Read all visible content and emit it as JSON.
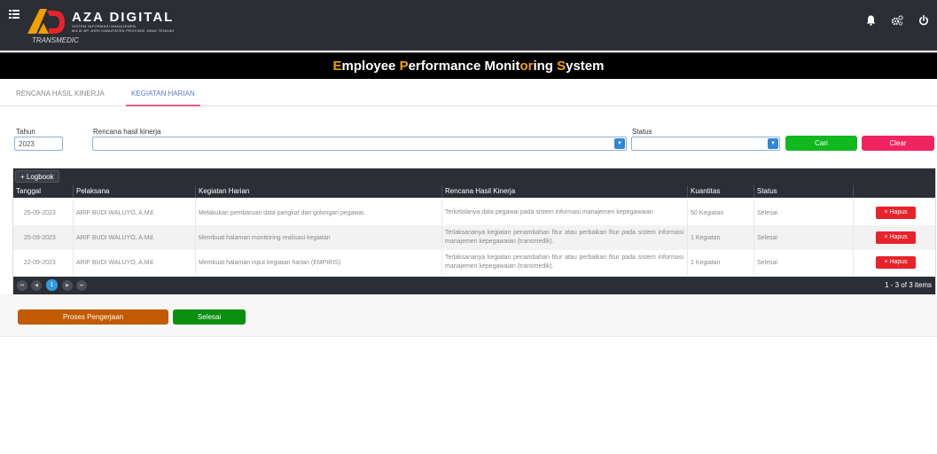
{
  "header": {
    "brand_title": "AZA DIGITAL",
    "brand_subtitle_1": "SISTEM INFORMASI MANAJEMEN",
    "brand_subtitle_2": "MILIK BP. ASRI KABUPATEN PROVINSI JAWA TENGAH",
    "brand_tagline": "TRANSMEDIC",
    "icons": [
      "menu-grid-icon",
      "bell-icon",
      "cogs-icon",
      "power-icon"
    ]
  },
  "page_title": {
    "parts": [
      {
        "text": "E",
        "highlight": true
      },
      {
        "text": "mployee ",
        "highlight": false
      },
      {
        "text": "P",
        "highlight": true
      },
      {
        "text": "erformance ",
        "highlight": false
      },
      {
        "text": "Monit",
        "highlight": false
      },
      {
        "text": "or",
        "highlight": true
      },
      {
        "text": "ing ",
        "highlight": false
      },
      {
        "text": "S",
        "highlight": true
      },
      {
        "text": "ystem",
        "highlight": false
      }
    ]
  },
  "tabs": [
    {
      "label": "RENCANA HASIL KINERJA",
      "active": false
    },
    {
      "label": "KEGIATAN HARIAN",
      "active": true
    }
  ],
  "filters": {
    "tahun_label": "Tahun",
    "tahun_value": "2023",
    "rencana_label": "Rencana hasil kinerja",
    "rencana_value": "",
    "status_label": "Status",
    "status_value": "",
    "cari_label": "Cari",
    "clear_label": "Clear"
  },
  "grid": {
    "logbook_label": "+ Logbook",
    "columns": [
      "Tanggal",
      "Pelaksana",
      "Kegiatan Harian",
      "Rencana Hasil Kinerja",
      "Kuantitas",
      "Status",
      ""
    ],
    "rows": [
      {
        "tanggal": "25-09-2023",
        "pelaksana": "ARIF BUDI WALUYO, A.Md.",
        "kegiatan": "Melakukan pembaruan data pangkat dan golongan pegawai.",
        "rencana": "Terkelolanya data pegawai pada sistem informasi manajemen kepegawaian",
        "kuantitas": "50 Kegiatan",
        "status": "Selesai",
        "action": "× Hapus"
      },
      {
        "tanggal": "25-09-2023",
        "pelaksana": "ARIF BUDI WALUYO, A.Md.",
        "kegiatan": "Membuat halaman monitoring realisasi kegiatan",
        "rencana": "Terlaksananya kegiatan penambahan fitur atau perbaikan fitur pada sistem informasi manajemen kepegawaian (transmedik).",
        "kuantitas": "1 Kegiatan",
        "status": "Selesai",
        "action": "× Hapus"
      },
      {
        "tanggal": "22-09-2023",
        "pelaksana": "ARIF BUDI WALUYO, A.Md.",
        "kegiatan": "Membuat halaman input kegiatan harian (EMPIRIS)",
        "rencana": "Terlaksananya kegiatan penambahan fitur atau perbaikan fitur pada sistem informasi manajemen kepegawaian (transmedik).",
        "kuantitas": "1 Kegiatan",
        "status": "Selesai",
        "action": "× Hapus"
      }
    ],
    "pager": {
      "first": "⏮",
      "prev": "◀",
      "current": "1",
      "next": "▶",
      "last": "⏭",
      "info": "1 - 3 of 3 items"
    }
  },
  "actions": {
    "proses_label": "Proses Pengerjaan",
    "selesai_label": "Selesai"
  },
  "colors": {
    "topbar": "#2b2e35",
    "accent_orange": "#f0a000",
    "cari_green": "#11b81e",
    "clear_pink": "#f0245f",
    "hapus_red": "#e8222a",
    "proses_orange": "#c15a00",
    "selesai_green": "#0a8f0f"
  }
}
